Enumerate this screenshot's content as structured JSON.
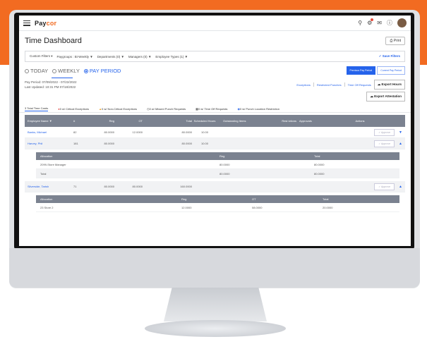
{
  "app": {
    "logo_main": "Pay",
    "logo_accent": "cor"
  },
  "header": {
    "title": "Time Dashboard",
    "print_label": "Print"
  },
  "filters": {
    "custom": "Custom Filters",
    "paygroups": "Paygroups : Bi-Weekly",
    "departments": "Departments (0)",
    "managers": "Managers (0)",
    "employee_types": "Employee Types (1)",
    "save": "Save Filters"
  },
  "tabs": {
    "today": "TODAY",
    "weekly": "WEEKLY",
    "pay_period": "PAY PERIOD"
  },
  "period_buttons": {
    "previous": "Previous Pay Period",
    "current": "Current Pay Period"
  },
  "pay_info": {
    "period": "Pay Period: 07/09/2022 - 07/22/2022",
    "updated": "Last Updated: 10:31 PM 07/18/2022"
  },
  "action_links": {
    "exceptions": "Exceptions",
    "restricted": "Restricted Punches",
    "time_off": "Time Off Requests",
    "export_hours": "Export Hours",
    "export_attestation": "Export Attestation"
  },
  "summary": {
    "total": "3 Total Time Cards",
    "critical": "0 w/ Critical Exceptions",
    "non_critical": "0 w/ Non-Critical Exceptions",
    "missed": "0 w/ Missed Punch Requests",
    "time_off": "0 w/ Time Off Requests",
    "location": "0 w/ Punch Location Restriction"
  },
  "grid": {
    "headers": {
      "name": "Employee Name",
      "num": "#",
      "reg": "Reg",
      "ot": "OT",
      "total": "Total",
      "scheduled": "Scheduled Hours",
      "outstanding": "Outstanding Items",
      "restrictions": "Rest ictions",
      "approvals": "Approvals",
      "actions": "Actions"
    },
    "approve_label": "Approve",
    "rows": [
      {
        "name": "Banks, Michael",
        "num": "82",
        "reg": "80.0000",
        "ot": "12.0000",
        "total": "80.0000",
        "scheduled": "10.00"
      },
      {
        "name": "Harvey, Phil",
        "num": "181",
        "reg": "80.0000",
        "ot": "",
        "total": "80.0000",
        "scheduled": "10.00"
      },
      {
        "name": "Silverside, Tarish",
        "num": "71",
        "reg": "80.0000",
        "ot": "80.0000",
        "total": "160.0000",
        "scheduled": ""
      }
    ]
  },
  "allocation_1": {
    "headers": {
      "allocation": "Allocation",
      "reg": "Reg",
      "total": "Total"
    },
    "rows": [
      {
        "allocation": "2099-Store Manager",
        "reg": "80.0000",
        "total": "80.0000"
      },
      {
        "allocation": "Total",
        "reg": "80.0000",
        "total": "80.0000"
      }
    ]
  },
  "allocation_2": {
    "headers": {
      "allocation": "Allocation",
      "reg": "Reg",
      "ot": "OT",
      "total": "Total"
    },
    "rows": [
      {
        "allocation": "23 Store 2",
        "reg": "12.0000",
        "ot": "08.0000",
        "total": "20.0000"
      }
    ]
  }
}
